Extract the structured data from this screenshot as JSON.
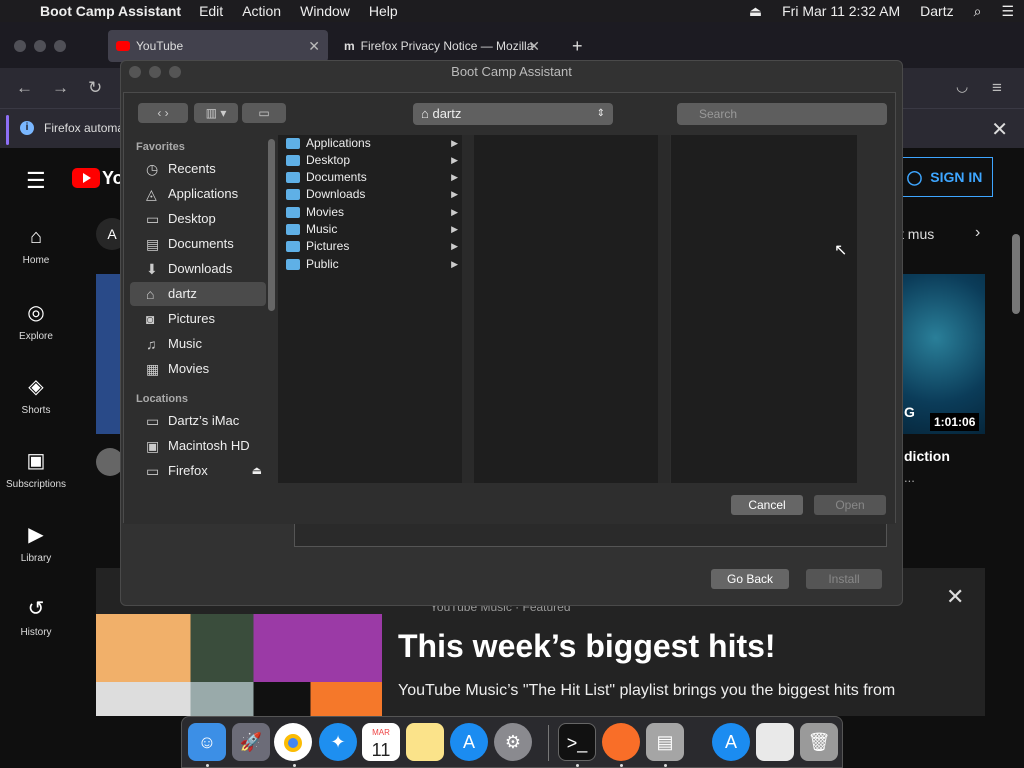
{
  "menubar": {
    "app": "Boot Camp Assistant",
    "items": [
      "Edit",
      "Action",
      "Window",
      "Help"
    ],
    "datetime": "Fri Mar 11  2:32 AM",
    "user": "Dartz"
  },
  "browser": {
    "tab1": "YouTube",
    "tab2": "Firefox Privacy Notice — Mozilla",
    "notification": "Firefox automa"
  },
  "youtube": {
    "logo": "Yo",
    "signin": "SIGN IN",
    "chip": "A",
    "music_chip": "t mus",
    "nav": [
      "Home",
      "Explore",
      "Shorts",
      "Subscriptions",
      "Library",
      "History"
    ],
    "video_letter": "G",
    "duration": "1:01:06",
    "video_title": "diction",
    "dots": "...",
    "promo_label": "YouTube Music · Featured",
    "promo_title": "This week’s biggest hits!",
    "promo_sub": "YouTube Music’s \"The Hit List\" playlist brings you the biggest hits from"
  },
  "bootcamp": {
    "title": "Boot Camp Assistant",
    "go_back": "Go Back",
    "install": "Install"
  },
  "dialog": {
    "path": "dartz",
    "search_placeholder": "Search",
    "favorites_header": "Favorites",
    "favorites": [
      {
        "label": "Recents",
        "icon": "clock-icon"
      },
      {
        "label": "Applications",
        "icon": "apps-icon"
      },
      {
        "label": "Desktop",
        "icon": "desktop-icon"
      },
      {
        "label": "Documents",
        "icon": "document-icon"
      },
      {
        "label": "Downloads",
        "icon": "download-icon"
      },
      {
        "label": "dartz",
        "icon": "home-icon"
      },
      {
        "label": "Pictures",
        "icon": "camera-icon"
      },
      {
        "label": "Music",
        "icon": "music-icon"
      },
      {
        "label": "Movies",
        "icon": "film-icon"
      }
    ],
    "locations_header": "Locations",
    "locations": [
      {
        "label": "Dartz’s iMac",
        "icon": "computer-icon"
      },
      {
        "label": "Macintosh HD",
        "icon": "disk-icon"
      },
      {
        "label": "Firefox",
        "icon": "disk-icon"
      }
    ],
    "folders": [
      "Applications",
      "Desktop",
      "Documents",
      "Downloads",
      "Movies",
      "Music",
      "Pictures",
      "Public"
    ],
    "cancel": "Cancel",
    "open": "Open"
  },
  "dock": [
    "Finder",
    "Launchpad",
    "Chrome",
    "Safari",
    "Calendar",
    "Notes",
    "App Store",
    "System Preferences",
    "Terminal",
    "Firefox",
    "Boot Camp",
    "App Store 2",
    "Document",
    "Trash"
  ],
  "calendar": {
    "month": "MAR",
    "day": "11"
  }
}
